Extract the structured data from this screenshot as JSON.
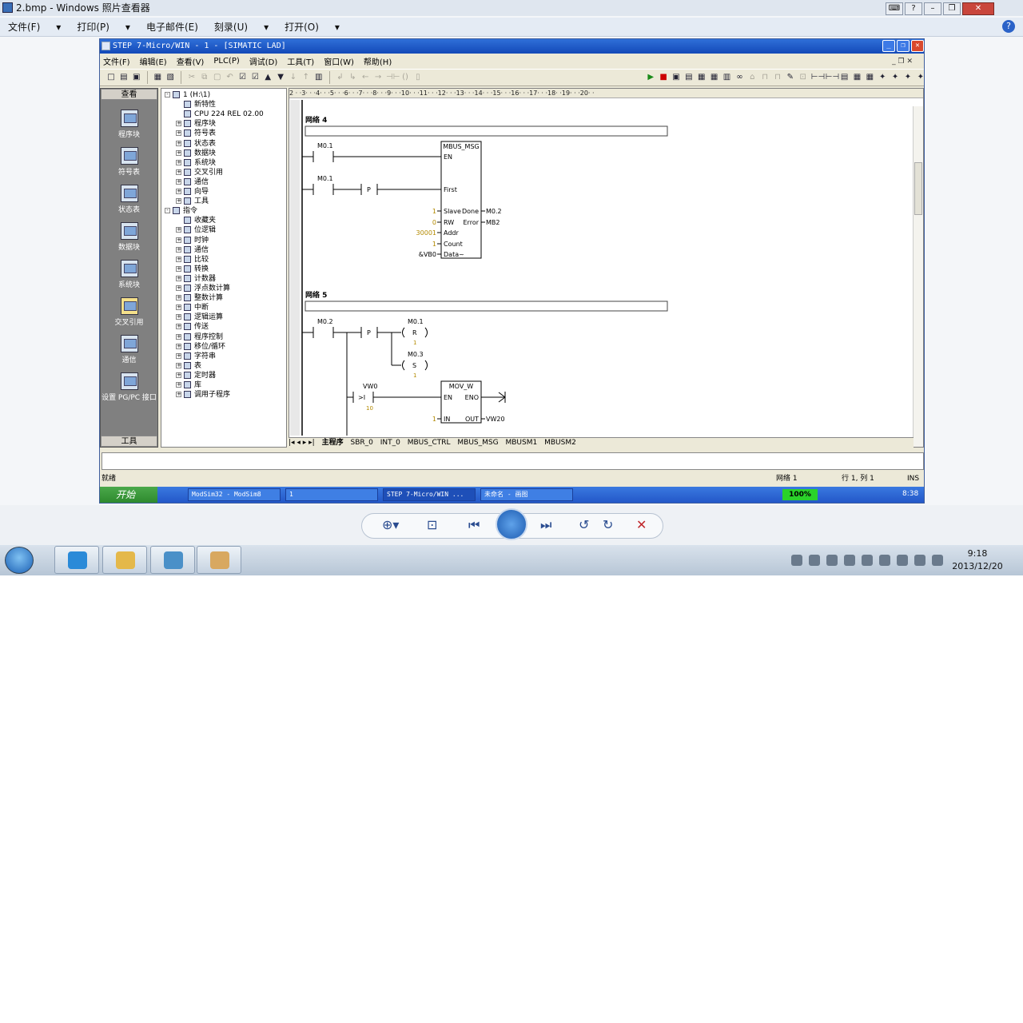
{
  "viewer": {
    "title": "2.bmp - Windows 照片查看器",
    "menu": [
      "文件(F)",
      "打印(P)",
      "电子邮件(E)",
      "刻录(U)",
      "打开(O)"
    ],
    "help_glyph": "?"
  },
  "step7": {
    "title": "STEP 7-Micro/WIN - 1 - [SIMATIC LAD]",
    "menu": [
      "文件(F)",
      "编辑(E)",
      "查看(V)",
      "PLC(P)",
      "调试(D)",
      "工具(T)",
      "窗口(W)",
      "帮助(H)"
    ],
    "nav": {
      "header": "查看",
      "footer": "工具",
      "items": [
        "程序块",
        "符号表",
        "状态表",
        "数据块",
        "系统块",
        "交叉引用",
        "通信",
        "设置 PG/PC 接口"
      ]
    },
    "tree": [
      {
        "label": "1 (H:\\1)",
        "level": 0,
        "pm": "-"
      },
      {
        "label": "新特性",
        "level": 1,
        "pm": ""
      },
      {
        "label": "CPU 224 REL 02.00",
        "level": 1,
        "pm": ""
      },
      {
        "label": "程序块",
        "level": 1,
        "pm": "+"
      },
      {
        "label": "符号表",
        "level": 1,
        "pm": "+"
      },
      {
        "label": "状态表",
        "level": 1,
        "pm": "+"
      },
      {
        "label": "数据块",
        "level": 1,
        "pm": "+"
      },
      {
        "label": "系统块",
        "level": 1,
        "pm": "+"
      },
      {
        "label": "交叉引用",
        "level": 1,
        "pm": "+"
      },
      {
        "label": "通信",
        "level": 1,
        "pm": "+"
      },
      {
        "label": "向导",
        "level": 1,
        "pm": "+"
      },
      {
        "label": "工具",
        "level": 1,
        "pm": "+"
      },
      {
        "label": "指令",
        "level": 0,
        "pm": "-"
      },
      {
        "label": "收藏夹",
        "level": 1,
        "pm": ""
      },
      {
        "label": "位逻辑",
        "level": 1,
        "pm": "+"
      },
      {
        "label": "时钟",
        "level": 1,
        "pm": "+"
      },
      {
        "label": "通信",
        "level": 1,
        "pm": "+"
      },
      {
        "label": "比较",
        "level": 1,
        "pm": "+"
      },
      {
        "label": "转换",
        "level": 1,
        "pm": "+"
      },
      {
        "label": "计数器",
        "level": 1,
        "pm": "+"
      },
      {
        "label": "浮点数计算",
        "level": 1,
        "pm": "+"
      },
      {
        "label": "整数计算",
        "level": 1,
        "pm": "+"
      },
      {
        "label": "中断",
        "level": 1,
        "pm": "+"
      },
      {
        "label": "逻辑运算",
        "level": 1,
        "pm": "+"
      },
      {
        "label": "传送",
        "level": 1,
        "pm": "+"
      },
      {
        "label": "程序控制",
        "level": 1,
        "pm": "+"
      },
      {
        "label": "移位/循环",
        "level": 1,
        "pm": "+"
      },
      {
        "label": "字符串",
        "level": 1,
        "pm": "+"
      },
      {
        "label": "表",
        "level": 1,
        "pm": "+"
      },
      {
        "label": "定时器",
        "level": 1,
        "pm": "+"
      },
      {
        "label": "库",
        "level": 1,
        "pm": "+"
      },
      {
        "label": "调用子程序",
        "level": 1,
        "pm": "+"
      }
    ],
    "ruler": "2 · ·3· · ·4· · ·5· · ·6· · ·7· · ·8· · ·9· · ·10· · ·11· · ·12· · ·13· · ·14· · ·15· · ·16· · ·17· · ·18· ·19· · ·20· ·",
    "tabs": [
      "主程序",
      "SBR_0",
      "INT_0",
      "MBUS_CTRL",
      "MBUS_MSG",
      "MBUSM1",
      "MBUSM2"
    ],
    "status": {
      "left": "就绪",
      "network": "网络 1",
      "position": "行 1, 列 1",
      "mode": "INS"
    },
    "taskbar": {
      "start": "开始",
      "items": [
        "ModSim32 - ModSim8",
        "1",
        "STEP 7-Micro/WIN ...",
        "未命名 - 画图"
      ],
      "zoom": "100%",
      "time": "8:38"
    }
  },
  "ladder": {
    "net4": {
      "title": "网络 4",
      "c1": "M0.1",
      "c2": "M0.1",
      "p": "P",
      "block": "MBUS_MSG",
      "en": "EN",
      "first": "First",
      "slave": "Slave",
      "rw": "RW",
      "addr": "Addr",
      "count": "Count",
      "data": "Data~",
      "done": "Done",
      "error": "Error",
      "v_slave": "1",
      "v_rw": "0",
      "v_addr": "30001",
      "v_count": "1",
      "v_data": "&VB0",
      "o_done": "M0.2",
      "o_error": "MB2"
    },
    "net5": {
      "title": "网络 5",
      "c1": "M0.2",
      "p": "P",
      "coil1": "M0.1",
      "coil1_t": "R",
      "coil1_n": "1",
      "coil2": "M0.3",
      "coil2_t": "S",
      "coil2_n": "1",
      "cmp_var": "VW0",
      "cmp_op": ">I",
      "cmp_val": "10",
      "block": "MOV_W",
      "en": "EN",
      "eno": "ENO",
      "in": "IN",
      "out": "OUT",
      "in_val": "1",
      "out_val": "VW20"
    }
  },
  "win_tray": {
    "time": "9:18",
    "date": "2013/12/20"
  },
  "colors": {
    "titlebar": "#2f6fd8",
    "param_value": "#b38a00"
  }
}
